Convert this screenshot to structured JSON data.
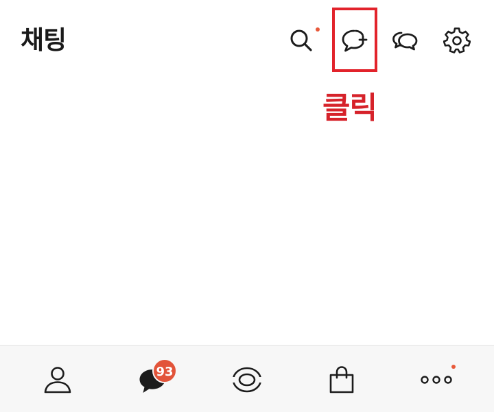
{
  "header": {
    "title": "채팅",
    "icons": {
      "search": "search-icon",
      "new_chat": "new-chat-icon",
      "open_chat": "open-chat-icon",
      "settings": "gear-icon"
    }
  },
  "annotation": {
    "text": "클릭"
  },
  "bottom_nav": {
    "items": [
      {
        "icon": "person-icon"
      },
      {
        "icon": "chat-bubble-icon",
        "badge": "93"
      },
      {
        "icon": "eye-icon"
      },
      {
        "icon": "shopping-bag-icon"
      },
      {
        "icon": "more-icon"
      }
    ]
  },
  "colors": {
    "notification_dot": "#e8593a",
    "badge": "#e2543a",
    "highlight": "#e2232b",
    "annotation_text": "#d6222a",
    "icon": "#1c1c1c"
  }
}
